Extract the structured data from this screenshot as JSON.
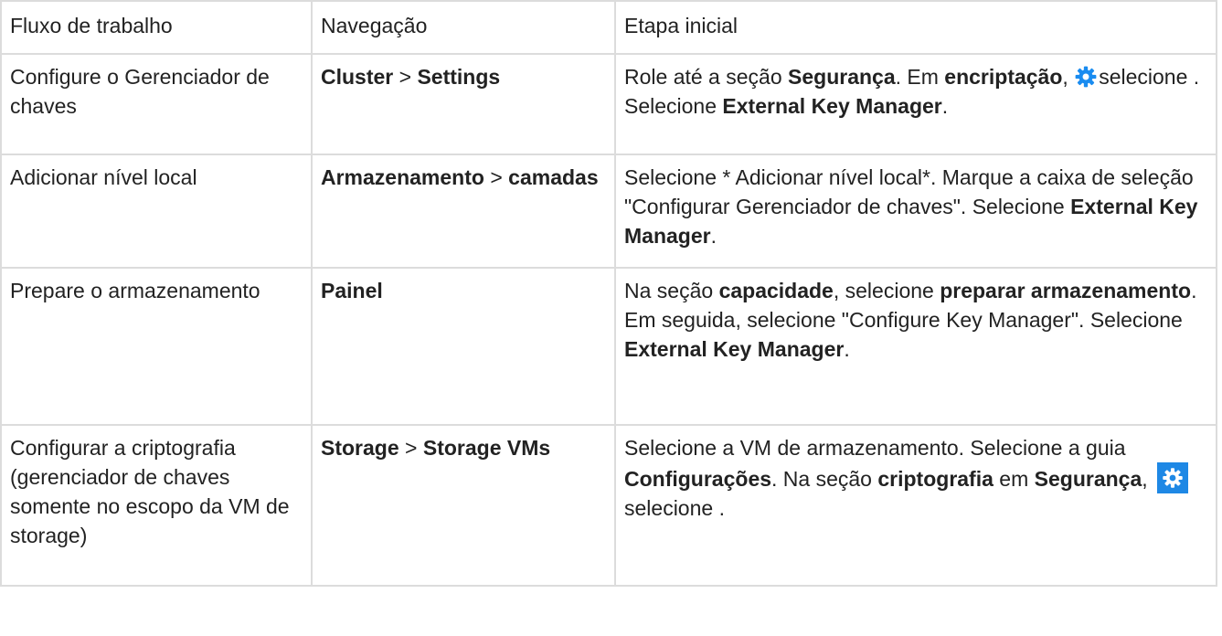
{
  "table": {
    "headers": [
      "Fluxo de trabalho",
      "Navegação",
      "Etapa inicial"
    ],
    "rows": [
      {
        "workflow": "Configure o Gerenciador de chaves",
        "nav": {
          "first": "Cluster",
          "sep": " > ",
          "second": "Settings"
        },
        "step": {
          "t1": "Role até a seção ",
          "b1": "Segurança",
          "t2": ". Em ",
          "b2": "encriptação",
          "t3": ",",
          "icon": "settings-gear-icon",
          "t4": "selecione . Selecione ",
          "b3": "External Key Manager",
          "t5": "."
        }
      },
      {
        "workflow": "Adicionar nível local",
        "nav": {
          "first": "Armazenamento",
          "sep": " > ",
          "second": "camadas"
        },
        "step": {
          "t1": "Selecione * Adicionar nível local*. Marque a caixa de seleção \"Configurar Gerenciador de chaves\". Selecione ",
          "b1": "External Key Manager",
          "t2": "."
        }
      },
      {
        "workflow": "Prepare o armazenamento",
        "nav": {
          "first": "Painel"
        },
        "step": {
          "t1": "Na seção ",
          "b1": "capacidade",
          "t2": ", selecione ",
          "b2": "preparar armazenamento",
          "t3": ". Em seguida, selecione \"Configure Key Manager\". Selecione ",
          "b3": "External Key Manager",
          "t4": "."
        }
      },
      {
        "workflow": "Configurar a criptografia (gerenciador de chaves somente no escopo da VM de storage)",
        "nav": {
          "first": "Storage",
          "sep": " > ",
          "second": "Storage VMs"
        },
        "step": {
          "t1": "Selecione a VM de armazenamento. Selecione a guia ",
          "b1": "Configurações",
          "t2": ". Na seção ",
          "b2": "criptografia",
          "t3": " em ",
          "b3": "Segurança",
          "t4": ", ",
          "icon": "settings-gear-icon",
          "t5": "selecione ."
        }
      }
    ]
  },
  "colors": {
    "text": "#222222",
    "border": "#dcdcdc",
    "icon_blue": "#1a8cf0",
    "icon_box": "#1e88e5"
  }
}
